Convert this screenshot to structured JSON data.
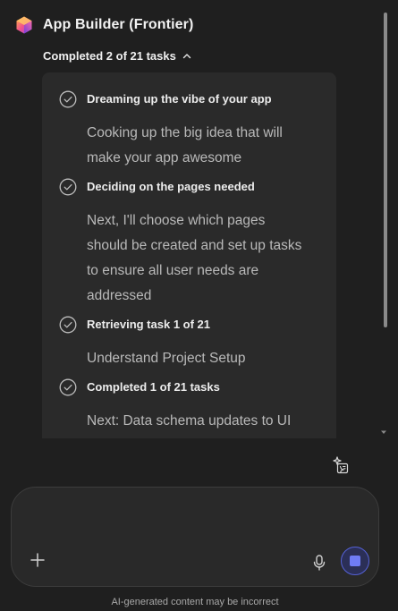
{
  "header": {
    "title": "App Builder (Frontier)",
    "logo_icon": "app-builder-logo-icon"
  },
  "progress": {
    "label": "Completed 2 of 21 tasks",
    "toggle_icon": "chevron-up-icon"
  },
  "tasks": [
    {
      "title": "Dreaming up the vibe of your app",
      "desc_lines": [
        "Cooking up the big idea that will",
        "make your app awesome"
      ],
      "status_icon": "check-circle-icon"
    },
    {
      "title": "Deciding on the pages needed",
      "desc_lines": [
        "Next, I'll choose which pages",
        "should be created and set up tasks",
        "to ensure all user needs are",
        "addressed"
      ],
      "status_icon": "check-circle-icon"
    },
    {
      "title": "Retrieving task 1 of 21",
      "desc_lines": [
        "Understand Project Setup"
      ],
      "status_icon": "check-circle-icon"
    },
    {
      "title": "Completed 1 of 21 tasks",
      "desc_lines": [
        "Next: Data schema updates to UI"
      ],
      "status_icon": "check-circle-icon"
    }
  ],
  "composer": {
    "placeholder": "",
    "add_icon": "plus-icon",
    "mic_icon": "microphone-icon",
    "stop_icon": "stop-icon"
  },
  "footer": {
    "disclaimer": "AI-generated content may be incorrect"
  },
  "colors": {
    "background": "#1f1f1f",
    "card": "#2a2a2a",
    "stop_accent": "#5561d6"
  }
}
